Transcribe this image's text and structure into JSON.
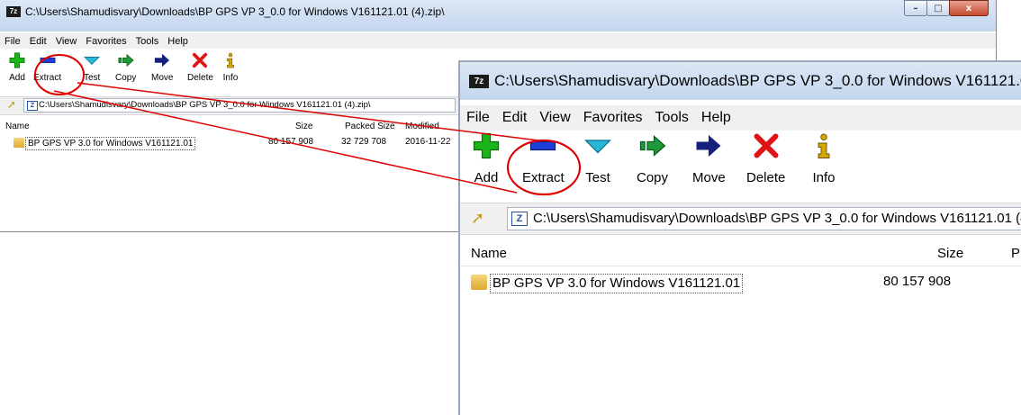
{
  "window": {
    "title": "C:\\Users\\Shamudisvary\\Downloads\\BP GPS VP 3_0.0 for Windows V161121.01 (4).zip\\",
    "app_icon": "7z",
    "minimize_glyph": "–",
    "maximize_glyph": "□",
    "close_glyph": "x"
  },
  "menu": [
    "File",
    "Edit",
    "View",
    "Favorites",
    "Tools",
    "Help"
  ],
  "toolbar": [
    {
      "label": "Add",
      "icon": "add-icon",
      "color": "#1bb51b"
    },
    {
      "label": "Extract",
      "icon": "extract-icon",
      "color": "#1e3fd8"
    },
    {
      "label": "Test",
      "icon": "test-icon",
      "color": "#27b8d8"
    },
    {
      "label": "Copy",
      "icon": "copy-icon",
      "color": "#1d9a3a"
    },
    {
      "label": "Move",
      "icon": "move-icon",
      "color": "#14207a"
    },
    {
      "label": "Delete",
      "icon": "delete-icon",
      "color": "#e01414"
    },
    {
      "label": "Info",
      "icon": "info-icon",
      "color": "#d4a800"
    }
  ],
  "address": {
    "path": "C:\\Users\\Shamudisvary\\Downloads\\BP GPS VP 3_0.0 for Windows V161121.01 (4).zip\\",
    "zip_glyph": "Z"
  },
  "columns": {
    "name": "Name",
    "size": "Size",
    "packed_size": "Packed Size",
    "modified": "Modified",
    "packed_short": "P"
  },
  "files": [
    {
      "name": "BP GPS VP 3.0 for Windows V161121.01",
      "size": "80 157 908",
      "packed_size": "32 729 708",
      "modified": "2016-11-22"
    }
  ],
  "annotation_color": "#e00000"
}
